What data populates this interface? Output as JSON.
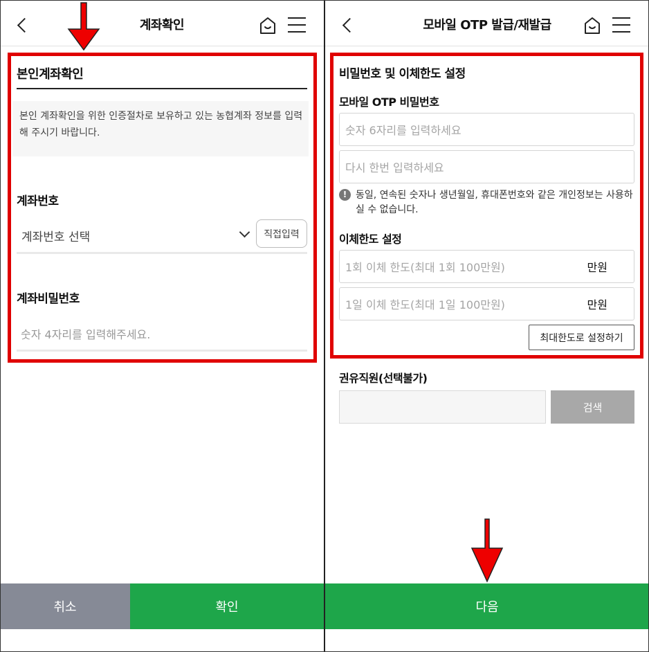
{
  "left": {
    "header": {
      "title": "계좌확인"
    },
    "section_title": "본인계좌확인",
    "notice": "본인 계좌확인을 위한 인증절차로 보유하고 있는 농협계좌 정보를 입력해 주시기 바랍니다.",
    "account_number": {
      "label": "계좌번호",
      "select_value": "계좌번호 선택",
      "direct_input_label": "직접입력"
    },
    "account_password": {
      "label": "계좌비밀번호",
      "placeholder": "숫자 4자리를 입력해주세요."
    },
    "buttons": {
      "cancel": "취소",
      "confirm": "확인"
    }
  },
  "right": {
    "header": {
      "title": "모바일 OTP 발급/재발급"
    },
    "section_title": "비밀번호 및 이체한도 설정",
    "otp_password": {
      "label": "모바일 OTP 비밀번호",
      "placeholder_1": "숫자 6자리를 입력하세요",
      "placeholder_2": "다시 한번 입력하세요",
      "warning": "동일, 연속된 숫자나 생년월일, 휴대폰번호와 같은 개인정보는 사용하실 수 없습니다."
    },
    "transfer_limit": {
      "label": "이체한도 설정",
      "once_placeholder": "1회 이체 한도(최대 1회 100만원)",
      "daily_placeholder": "1일 이체 한도(최대 1일 100만원)",
      "unit": "만원",
      "max_button": "최대한도로 설정하기"
    },
    "recommender": {
      "label": "권유직원(선택불가)",
      "search_button": "검색"
    },
    "buttons": {
      "next": "다음"
    }
  },
  "colors": {
    "accent_green": "#1ea64a",
    "cancel_gray": "#868a96",
    "highlight_red": "#e00000",
    "search_gray": "#a8a8a8"
  },
  "icons": [
    "back-icon",
    "home-icon",
    "menu-icon",
    "warning-icon",
    "chevron-down-icon",
    "down-arrow-annotation"
  ]
}
